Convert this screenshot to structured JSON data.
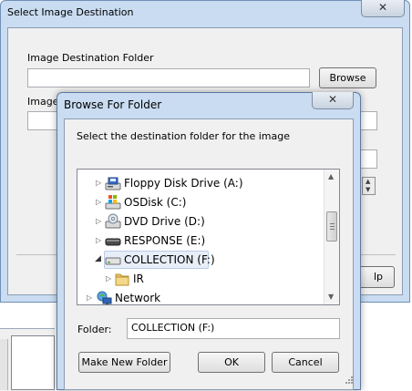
{
  "outer_dialog": {
    "title": "Select Image Destination",
    "close_glyph": "✕",
    "dest_folder_label": "Image Destination Folder",
    "dest_folder_value": "",
    "browse_label": "Browse",
    "second_label_partial": "Image",
    "help_partial": "lp"
  },
  "browse_dialog": {
    "title": "Browse For Folder",
    "close_glyph": "✕",
    "instruction": "Select the destination folder for the image",
    "tree": [
      {
        "label": "Floppy Disk Drive (A:)",
        "icon": "floppy-drive-icon",
        "expander": "collapsed"
      },
      {
        "label": "OSDisk (C:)",
        "icon": "windows-disk-icon",
        "expander": "collapsed"
      },
      {
        "label": "DVD Drive (D:)",
        "icon": "dvd-drive-icon",
        "expander": "collapsed"
      },
      {
        "label": "RESPONSE (E:)",
        "icon": "removable-drive-icon",
        "expander": "collapsed"
      },
      {
        "label": "COLLECTION (F:)",
        "icon": "drive-icon",
        "expander": "expanded",
        "selected": true
      },
      {
        "label": "IR",
        "icon": "folder-icon",
        "expander": "collapsed"
      },
      {
        "label": "Network",
        "icon": "network-icon",
        "expander": "collapsed"
      }
    ],
    "folder_label": "Folder:",
    "folder_value": "COLLECTION (F:)",
    "make_new_folder_label": "Make New Folder",
    "ok_label": "OK",
    "cancel_label": "Cancel"
  }
}
